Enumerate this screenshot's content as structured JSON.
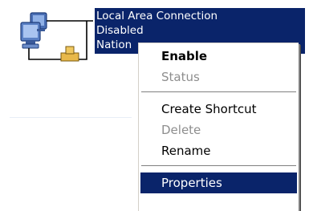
{
  "connection": {
    "name": "Local Area Connection",
    "status": "Disabled",
    "device": "Nation",
    "overflow": "..."
  },
  "context_menu": {
    "items": [
      {
        "label": "Enable",
        "state": "default-bold"
      },
      {
        "label": "Status",
        "state": "disabled"
      },
      {
        "label": "Create Shortcut",
        "state": "enabled"
      },
      {
        "label": "Delete",
        "state": "disabled"
      },
      {
        "label": "Rename",
        "state": "enabled"
      },
      {
        "label": "Properties",
        "state": "highlighted"
      }
    ]
  },
  "colors": {
    "selection": "#0a246a",
    "menu_bg": "#ffffff",
    "disabled_text": "#8e8e8e"
  },
  "icons": {
    "connection": "network-connection-icon"
  }
}
